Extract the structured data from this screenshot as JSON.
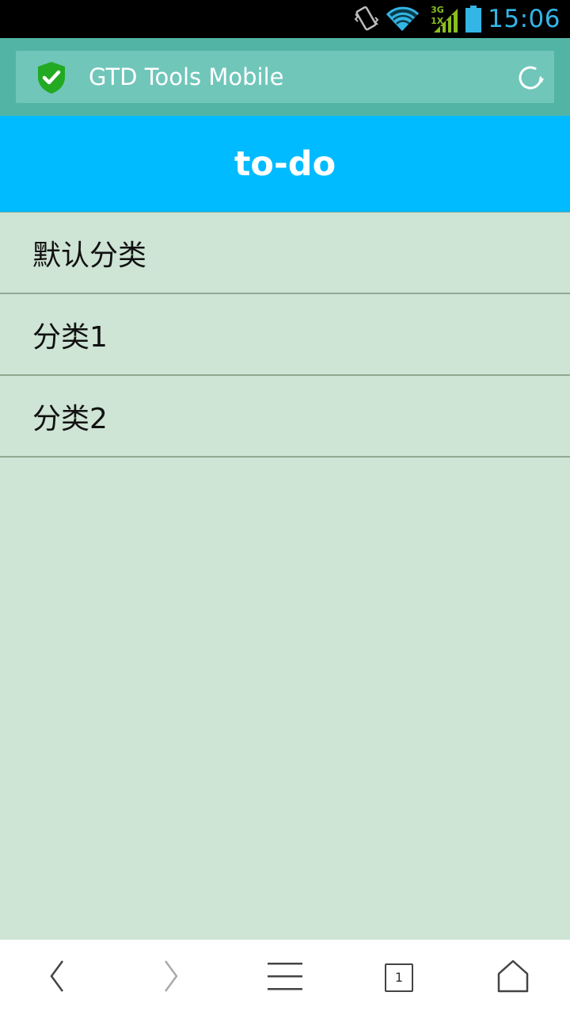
{
  "status_bar": {
    "time": "15:06",
    "network_label_top": "3G",
    "network_label_bottom": "1X",
    "icons": [
      "vibrate-icon",
      "wifi-icon",
      "signal-icon",
      "battery-icon"
    ],
    "accent_color": "#33b5e5"
  },
  "browser": {
    "page_title": "GTD Tools Mobile",
    "secure_icon": "shield-check-icon",
    "refresh_icon": "refresh-icon",
    "bar_color": "#52b4a4",
    "address_color": "#71c6ba"
  },
  "page": {
    "title": "to-do",
    "header_color": "#00bbff",
    "background_color": "#cee4d5"
  },
  "categories": [
    {
      "label": "默认分类"
    },
    {
      "label": "分类1"
    },
    {
      "label": "分类2"
    }
  ],
  "toolbar": {
    "tab_count": "1",
    "buttons": [
      "back-icon",
      "forward-icon",
      "menu-icon",
      "tabs-icon",
      "home-icon"
    ]
  }
}
